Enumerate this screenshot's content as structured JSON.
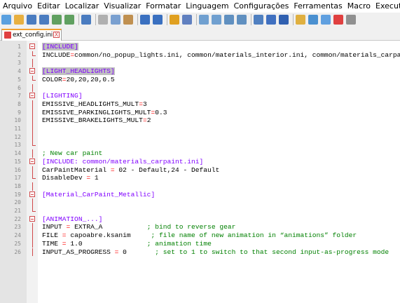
{
  "menu": [
    "Arquivo",
    "Editar",
    "Localizar",
    "Visualizar",
    "Formatar",
    "Linguagem",
    "Configurações",
    "Ferramentas",
    "Macro",
    "Executar"
  ],
  "toolbar_icons": [
    "new-file-icon",
    "open-file-icon",
    "save-icon",
    "save-all-icon",
    "close-icon",
    "close-all-icon",
    "print-icon",
    "cut-icon",
    "copy-icon",
    "paste-icon",
    "undo-icon",
    "redo-icon",
    "find-icon",
    "replace-icon",
    "zoom-in-icon",
    "zoom-out-icon",
    "sync-vertical-icon",
    "sync-horizontal-icon",
    "word-wrap-icon",
    "show-all-chars-icon",
    "indent-guide-icon",
    "folder-workspace-icon",
    "function-list-icon",
    "document-map-icon",
    "record-macro-icon",
    "stop-record-icon"
  ],
  "tab": {
    "label": "ext_config.ini",
    "close": "X"
  },
  "colors": {
    "section": "#8000ff",
    "operator": "#ff0000",
    "comment": "#008000",
    "highlight": "#c0c0c0",
    "fold": "#d0484a"
  },
  "lines": [
    {
      "n": "1",
      "tokens": [
        {
          "t": "[INCLUDE]",
          "c": "sec hl"
        }
      ]
    },
    {
      "n": "2",
      "tokens": [
        {
          "t": "INCLUDE"
        },
        {
          "t": "=",
          "c": "op"
        },
        {
          "t": "common/no_popup_lights.ini, common/materials_interior.ini, common/materials_carpaint.ini"
        }
      ]
    },
    {
      "n": "3",
      "tokens": []
    },
    {
      "n": "4",
      "tokens": [
        {
          "t": "[LIGHT_HEADLIGHTS]",
          "c": "sec hl"
        }
      ]
    },
    {
      "n": "5",
      "tokens": [
        {
          "t": "COLOR"
        },
        {
          "t": "=",
          "c": "op"
        },
        {
          "t": "20,20,20,0.5"
        }
      ]
    },
    {
      "n": "6",
      "tokens": []
    },
    {
      "n": "7",
      "tokens": [
        {
          "t": "[LIGHTING]",
          "c": "sec"
        }
      ]
    },
    {
      "n": "8",
      "tokens": [
        {
          "t": "EMISSIVE_HEADLIGHTS_MULT"
        },
        {
          "t": "=",
          "c": "op"
        },
        {
          "t": "3"
        }
      ]
    },
    {
      "n": "9",
      "tokens": [
        {
          "t": "EMISSIVE_PARKINGLIGHTS_MULT"
        },
        {
          "t": "=",
          "c": "op"
        },
        {
          "t": "0.3"
        }
      ]
    },
    {
      "n": "10",
      "tokens": [
        {
          "t": "EMISSIVE_BRAKELIGHTS_MULT"
        },
        {
          "t": "=",
          "c": "op"
        },
        {
          "t": "2"
        }
      ]
    },
    {
      "n": "11",
      "tokens": []
    },
    {
      "n": "12",
      "tokens": []
    },
    {
      "n": "13",
      "tokens": []
    },
    {
      "n": "14",
      "tokens": [
        {
          "t": "; New car paint",
          "c": "cm"
        }
      ]
    },
    {
      "n": "15",
      "tokens": [
        {
          "t": "[INCLUDE: common/materials_carpaint.ini]",
          "c": "sec"
        }
      ]
    },
    {
      "n": "16",
      "tokens": [
        {
          "t": "CarPaintMaterial "
        },
        {
          "t": "=",
          "c": "op"
        },
        {
          "t": " 02 - Default,24 - Default"
        }
      ]
    },
    {
      "n": "17",
      "tokens": [
        {
          "t": "DisableDev "
        },
        {
          "t": "=",
          "c": "op"
        },
        {
          "t": " 1"
        }
      ]
    },
    {
      "n": "18",
      "tokens": []
    },
    {
      "n": "19",
      "tokens": [
        {
          "t": "[Material_CarPaint_Metallic]",
          "c": "sec"
        }
      ]
    },
    {
      "n": "20",
      "tokens": []
    },
    {
      "n": "21",
      "tokens": []
    },
    {
      "n": "22",
      "tokens": [
        {
          "t": "[ANIMATION_...]",
          "c": "sec"
        }
      ]
    },
    {
      "n": "23",
      "tokens": [
        {
          "t": "INPUT "
        },
        {
          "t": "=",
          "c": "op"
        },
        {
          "t": " EXTRA_A           "
        },
        {
          "t": "; bind to reverse gear",
          "c": "cm"
        }
      ]
    },
    {
      "n": "24",
      "tokens": [
        {
          "t": "FILE "
        },
        {
          "t": "=",
          "c": "op"
        },
        {
          "t": " capoabre.ksanim     "
        },
        {
          "t": "; file name of new animation in “animations” folder",
          "c": "cm"
        }
      ]
    },
    {
      "n": "25",
      "tokens": [
        {
          "t": "TIME "
        },
        {
          "t": "=",
          "c": "op"
        },
        {
          "t": " 1.0                "
        },
        {
          "t": "; animation time",
          "c": "cm"
        }
      ]
    },
    {
      "n": "26",
      "tokens": [
        {
          "t": "INPUT_AS_PROGRESS "
        },
        {
          "t": "=",
          "c": "op"
        },
        {
          "t": " 0       "
        },
        {
          "t": "; set to 1 to switch to that second input-as-progress mode",
          "c": "cm"
        }
      ]
    }
  ]
}
